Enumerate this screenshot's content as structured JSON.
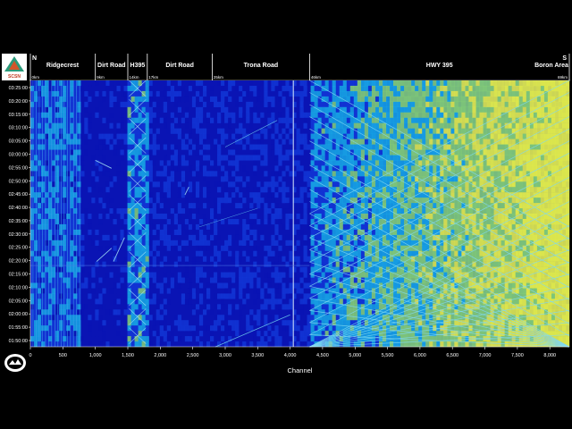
{
  "chart_data": {
    "type": "heatmap",
    "title": "",
    "xlabel": "Channel",
    "ylabel": "",
    "xlim": [
      0,
      8300
    ],
    "x_ticks": [
      0,
      500,
      1000,
      1500,
      2000,
      2500,
      3000,
      3500,
      4000,
      4500,
      5000,
      5500,
      6000,
      6500,
      7000,
      7500,
      8000
    ],
    "x_tick_labels": [
      "0",
      "500",
      "1,000",
      "1,500",
      "2,000",
      "2,500",
      "3,000",
      "3,500",
      "4,000",
      "4,500",
      "5,000",
      "5,500",
      "6,000",
      "6,500",
      "7,000",
      "7,500",
      "8,000"
    ],
    "y_tick_labels": [
      "03:25:00",
      "03:20:00",
      "03:15:00",
      "03:10:00",
      "03:05:00",
      "03:00:00",
      "02:55:00",
      "02:50:00",
      "02:45:00",
      "02:40:00",
      "02:35:00",
      "02:30:00",
      "02:25:00",
      "02:20:00",
      "02:15:00",
      "02:10:00",
      "02:05:00",
      "02:00:00",
      "01:55:00",
      "01:50:00"
    ],
    "colormap": [
      "#0a14b4",
      "#1440e0",
      "#19c0ee",
      "#8fe070",
      "#e6f048"
    ],
    "segments": [
      {
        "channel": 0,
        "name": "Ridgecrest",
        "km": "0km",
        "dir": "N"
      },
      {
        "channel": 1000,
        "name": "Dirt Road",
        "km": "9km",
        "dir": ""
      },
      {
        "channel": 1500,
        "name": "H395",
        "km": "14km",
        "dir": ""
      },
      {
        "channel": 1800,
        "name": "Dirt Road",
        "km": "17km",
        "dir": ""
      },
      {
        "channel": 2800,
        "name": "Trona Road",
        "km": "25km",
        "dir": ""
      },
      {
        "channel": 4300,
        "name": "HWY 395",
        "km": "46km",
        "dir": ""
      },
      {
        "channel": 8300,
        "name": "Boron Area",
        "km": "69km",
        "dir": "S"
      }
    ]
  },
  "logo": {
    "top_text": "SCSN"
  }
}
